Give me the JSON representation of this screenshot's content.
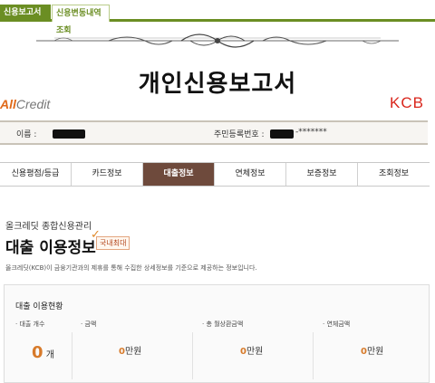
{
  "top_tabs": [
    {
      "label": "신용보고서조회"
    },
    {
      "label": "신용변동내역조회"
    }
  ],
  "report": {
    "title": "개인신용보고서",
    "brand_left_prefix": "All",
    "brand_left_suffix": "Credit",
    "brand_right": "KCB"
  },
  "info": {
    "name_label": "이름 :",
    "ssn_label": "주민등록번호 :",
    "ssn_mask": "-*******"
  },
  "nav_tabs": [
    {
      "label": "신용평점/등급"
    },
    {
      "label": "카드정보"
    },
    {
      "label": "대출정보"
    },
    {
      "label": "연체정보"
    },
    {
      "label": "보증정보"
    },
    {
      "label": "조회정보"
    }
  ],
  "section": {
    "subhead": "올크레딧 종합신용관리",
    "title": "대출 이용정보",
    "badge": "국내최대",
    "description": "올크레딧(KCB)이 금융기관과의 제휴를 통해 수집한 상세정보를 기준으로 제공하는 정보입니다."
  },
  "loan_status": {
    "title": "대출 이용현황",
    "items": [
      {
        "label": "· 대출 개수",
        "value": "0",
        "unit": "개"
      },
      {
        "label": "· 금액",
        "value": "0",
        "unit": "만원"
      },
      {
        "label": "· 총 월상환금액",
        "value": "0",
        "unit": "만원"
      },
      {
        "label": "· 연체금액",
        "value": "0",
        "unit": "만원"
      }
    ]
  },
  "colors": {
    "accent_green": "#6b8e23",
    "active_tab": "#6e4a3c",
    "value_orange": "#d77a2a",
    "kcb_red": "#d9261c"
  }
}
